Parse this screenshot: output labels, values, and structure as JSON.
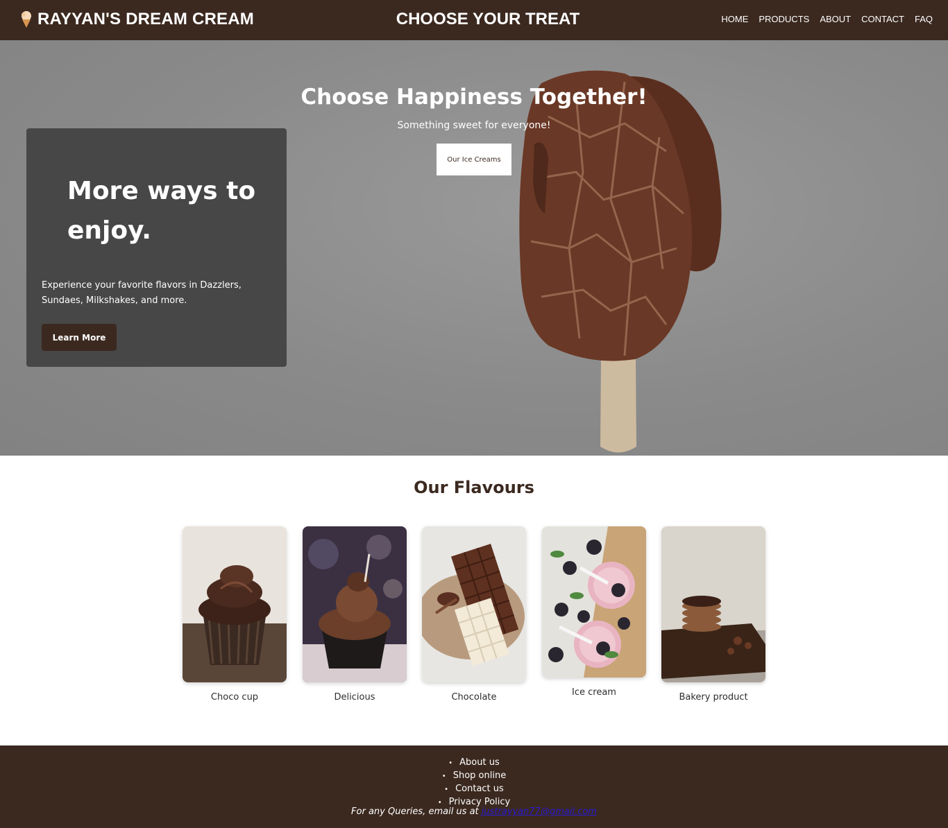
{
  "header": {
    "brand": "RAYYAN'S DREAM CREAM",
    "brand_icon": "ice-cream-cone-icon",
    "center_title": "CHOOSE YOUR TREAT",
    "nav": [
      "HOME",
      "PRODUCTS",
      "ABOUT",
      "CONTACT",
      "FAQ"
    ]
  },
  "hero": {
    "title": "Choose Happiness Together!",
    "subtitle": "Something sweet for everyone!",
    "button": "Our Ice Creams",
    "background_image": "chocolate-ice-cream-bar"
  },
  "promo": {
    "title": "More ways to enjoy.",
    "text": "Experience your favorite flavors in Dazzlers, Sundaes, Milkshakes, and more.",
    "button": "Learn More"
  },
  "flavours": {
    "title": "Our Flavours",
    "items": [
      {
        "label": "Choco cup",
        "image": "chocolate-cupcake"
      },
      {
        "label": "Delicious",
        "image": "chocolate-dessert-cup"
      },
      {
        "label": "Chocolate",
        "image": "chocolate-bars-plate"
      },
      {
        "label": "Ice cream",
        "image": "berry-smoothies"
      },
      {
        "label": "Bakery product",
        "image": "chocolate-pancakes"
      }
    ]
  },
  "footer": {
    "links": [
      "About us",
      "Shop online",
      "Contact us",
      "Privacy Policy"
    ],
    "query_text": "For any Queries, email us at ",
    "email": "justrayyan77@gmail.com"
  },
  "colors": {
    "brand_brown": "#3b2920",
    "hero_gray": "#8c8c8c",
    "promo_gray": "#474747"
  }
}
